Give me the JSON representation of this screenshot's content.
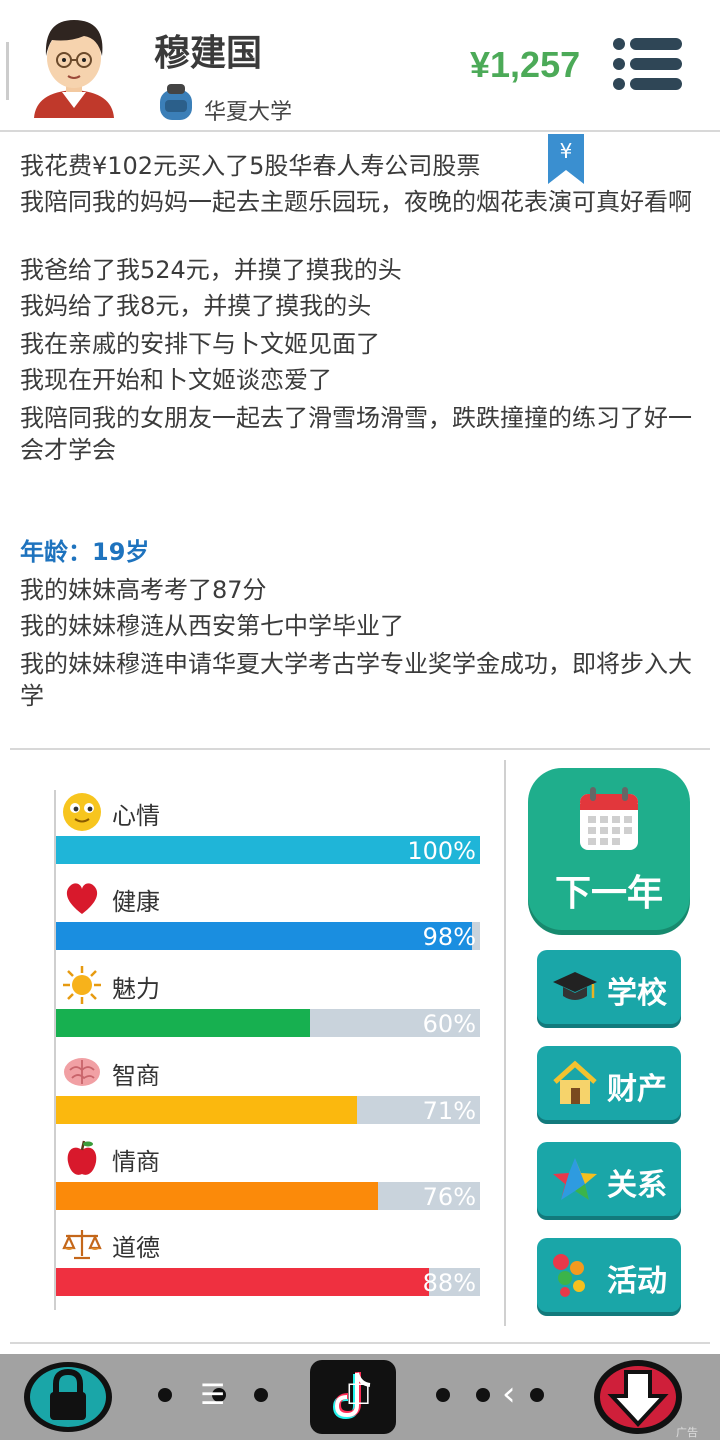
{
  "header": {
    "name": "穆建国",
    "school": "华夏大学",
    "money": "¥1,257",
    "menu_icon": "hamburger-menu-icon"
  },
  "log": {
    "bookmark_symbol": "¥",
    "lines": [
      "我花费¥102元买入了5股华春人寿公司股票",
      "我陪同我的妈妈一起去主题乐园玩，夜晚的烟花表演可真好看啊",
      "我爸给了我524元，并摸了摸我的头",
      "我妈给了我8元，并摸了摸我的头",
      "我在亲戚的安排下与卜文姬见面了",
      "我现在开始和卜文姬谈恋爱了",
      "我陪同我的女朋友一起去了滑雪场滑雪，跌跌撞撞的练习了好一会才学会"
    ],
    "age_heading": "年龄：19岁",
    "age_lines": [
      "我的妹妹高考考了87分",
      "我的妹妹穆涟从西安第七中学毕业了",
      "我的妹妹穆涟申请华夏大学考古学专业奖学金成功，即将步入大学"
    ]
  },
  "stats": [
    {
      "label": "心情",
      "percent": 100,
      "text": "100%",
      "color": "#1fb5d8",
      "icon": "smiley-icon"
    },
    {
      "label": "健康",
      "percent": 98,
      "text": "98%",
      "color": "#1a8ee0",
      "icon": "heart-icon"
    },
    {
      "label": "魅力",
      "percent": 60,
      "text": "60%",
      "color": "#17b050",
      "icon": "sun-icon"
    },
    {
      "label": "智商",
      "percent": 71,
      "text": "71%",
      "color": "#fbb80e",
      "icon": "brain-icon"
    },
    {
      "label": "情商",
      "percent": 76,
      "text": "76%",
      "color": "#fb8a0a",
      "icon": "apple-icon"
    },
    {
      "label": "道德",
      "percent": 88,
      "text": "88%",
      "color": "#ef3040",
      "icon": "scales-icon"
    }
  ],
  "buttons": {
    "next_year": "下一年",
    "school": "学校",
    "property": "财产",
    "relations": "关系",
    "activities": "活动"
  },
  "bottom": {
    "nav_menu": "☰",
    "nav_home": "☐",
    "nav_back": "‹",
    "ad_label": "广告"
  }
}
